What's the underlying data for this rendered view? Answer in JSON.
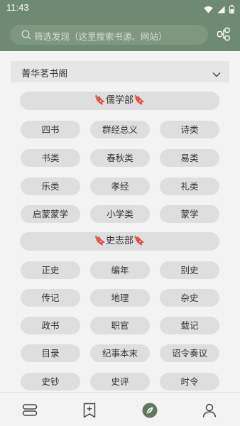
{
  "status": {
    "time": "11:43"
  },
  "search": {
    "placeholder": "筛选发现（这里搜索书源、网站）"
  },
  "source_select": {
    "selected": " 菁华茗书阁"
  },
  "sections": [
    {
      "title": "🔖儒学部🔖",
      "items": [
        "四书",
        "群经总义",
        "诗类",
        "书类",
        "春秋类",
        "易类",
        "乐类",
        "孝经",
        "礼类",
        "启蒙蒙学",
        "小学类",
        "蒙学"
      ]
    },
    {
      "title": "🔖史志部🔖",
      "items": [
        "正史",
        "编年",
        "别史",
        "传记",
        "地理",
        "杂史",
        "政书",
        "职官",
        "载记",
        "目录",
        "纪事本末",
        "诏令奏议",
        "史钞",
        "史评",
        "时令"
      ]
    }
  ],
  "bottom_nav": [
    "bookshelf-icon",
    "subscription-icon",
    "explore-icon",
    "profile-icon"
  ],
  "colors": {
    "header": "#6f8a72",
    "chip": "#dedede",
    "background": "#f3f3f3",
    "accent": "#5d7a60"
  }
}
